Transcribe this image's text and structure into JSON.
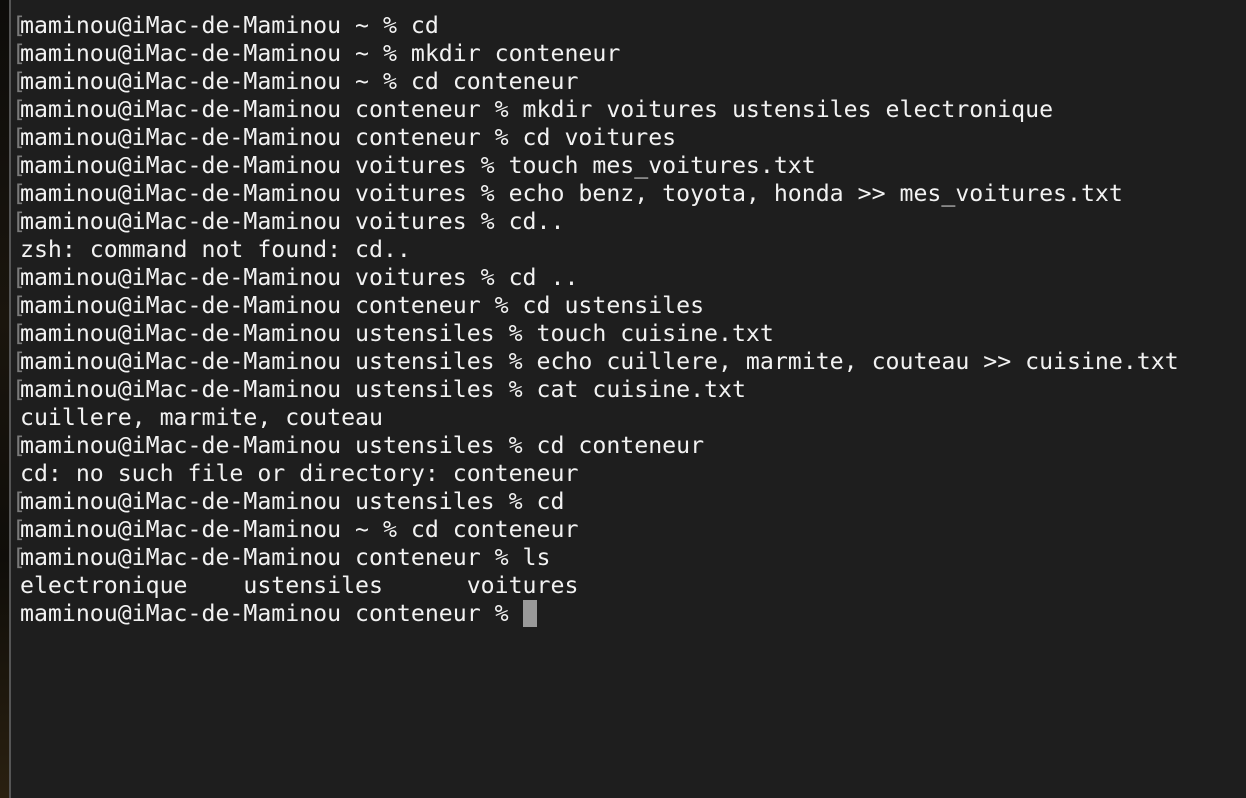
{
  "terminal": {
    "colors": {
      "background": "#1e1e1e",
      "text": "#f2f2f2",
      "cursor": "#9a9a9a",
      "mark": "#7a7a7a"
    },
    "mark_glyph": "[",
    "lines": [
      {
        "text": "maminou@iMac-de-Maminou ~ % cd",
        "marked": true
      },
      {
        "text": "maminou@iMac-de-Maminou ~ % mkdir conteneur",
        "marked": true
      },
      {
        "text": "maminou@iMac-de-Maminou ~ % cd conteneur",
        "marked": true
      },
      {
        "text": "maminou@iMac-de-Maminou conteneur % mkdir voitures ustensiles electronique",
        "marked": true
      },
      {
        "text": "maminou@iMac-de-Maminou conteneur % cd voitures",
        "marked": true
      },
      {
        "text": "maminou@iMac-de-Maminou voitures % touch mes_voitures.txt",
        "marked": true
      },
      {
        "text": "maminou@iMac-de-Maminou voitures % echo benz, toyota, honda >> mes_voitures.txt",
        "marked": true
      },
      {
        "text": "maminou@iMac-de-Maminou voitures % cd..",
        "marked": true
      },
      {
        "text": "zsh: command not found: cd..",
        "marked": false
      },
      {
        "text": "maminou@iMac-de-Maminou voitures % cd ..",
        "marked": true
      },
      {
        "text": "maminou@iMac-de-Maminou conteneur % cd ustensiles",
        "marked": true
      },
      {
        "text": "maminou@iMac-de-Maminou ustensiles % touch cuisine.txt",
        "marked": true
      },
      {
        "text": "maminou@iMac-de-Maminou ustensiles % echo cuillere, marmite, couteau >> cuisine.txt",
        "marked": true
      },
      {
        "text": "maminou@iMac-de-Maminou ustensiles % cat cuisine.txt",
        "marked": true
      },
      {
        "text": "cuillere, marmite, couteau",
        "marked": false
      },
      {
        "text": "maminou@iMac-de-Maminou ustensiles % cd conteneur",
        "marked": true
      },
      {
        "text": "cd: no such file or directory: conteneur",
        "marked": false
      },
      {
        "text": "maminou@iMac-de-Maminou ustensiles % cd",
        "marked": true
      },
      {
        "text": "maminou@iMac-de-Maminou ~ % cd conteneur",
        "marked": true
      },
      {
        "text": "maminou@iMac-de-Maminou conteneur % ls",
        "marked": true
      },
      {
        "text": "electronique    ustensiles      voitures",
        "marked": false
      }
    ],
    "prompt": "maminou@iMac-de-Maminou conteneur % "
  }
}
